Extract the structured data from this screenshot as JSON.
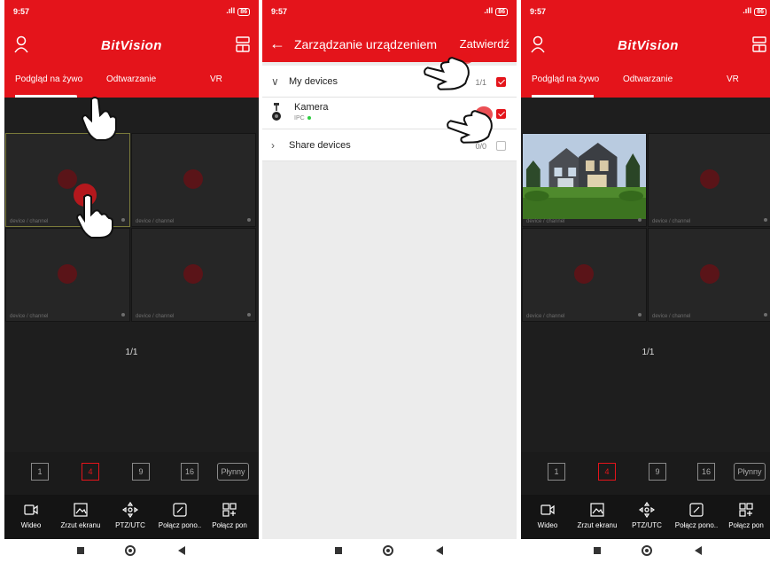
{
  "status": {
    "time": "9:57",
    "signal": ".ıll",
    "battery": "86"
  },
  "app": {
    "brand": "BitVision",
    "tabs": [
      "Podgląd na żywo",
      "Odtwarzanie",
      "VR"
    ],
    "cell_caption": "device / channel",
    "pager": "1/1",
    "layouts": [
      "1",
      "4",
      "9",
      "16"
    ],
    "smooth_label": "Płynny",
    "bottom_items": [
      "Wideo",
      "Zrzut ekranu",
      "PTZ/UTC",
      "Połącz pono..",
      "Połącz pon"
    ]
  },
  "device_manager": {
    "title": "Zarządzanie urządzeniem",
    "confirm": "Zatwierdź",
    "my_devices": {
      "label": "My devices",
      "count": "1/1",
      "checked": true
    },
    "device": {
      "name": "Kamera",
      "type": "IPC",
      "online": true,
      "checked": true
    },
    "share_devices": {
      "label": "Share devices",
      "count": "0/0",
      "checked": false
    }
  },
  "colors": {
    "brand_red": "#e4141b",
    "dark_bg": "#1e1e1e",
    "online_green": "#2ecc40"
  },
  "icons": [
    "user-icon",
    "layout-icon",
    "back-arrow-icon",
    "chevron-down-icon",
    "chevron-right-icon",
    "camera-icon",
    "video-icon",
    "screenshot-icon",
    "ptz-icon",
    "connect-icon",
    "hand-pointer-icon"
  ]
}
